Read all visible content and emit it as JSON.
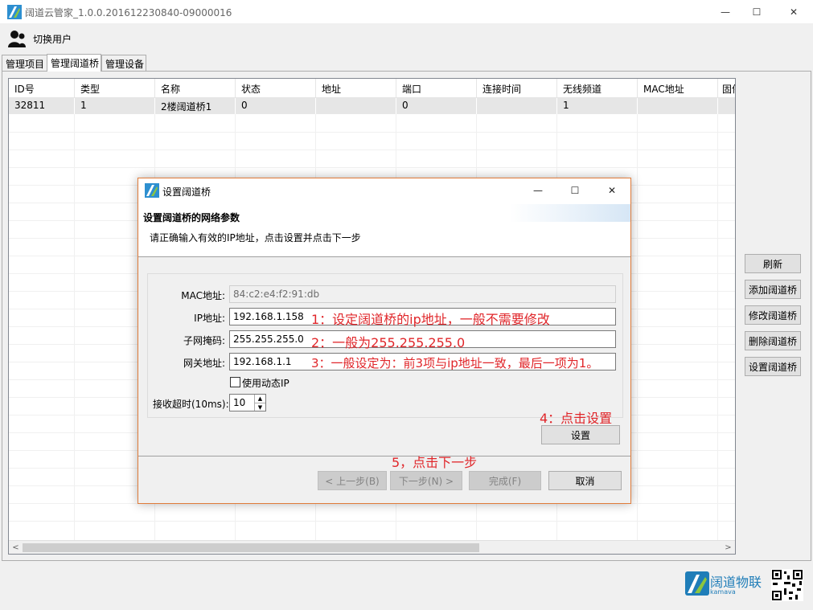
{
  "window": {
    "title": "阔道云管家_1.0.0.201612230840-09000016",
    "minimize": "—",
    "maximize": "☐",
    "close": "✕"
  },
  "toolbar": {
    "switch_user": "切换用户"
  },
  "tabs": [
    "管理项目",
    "管理阔道桥",
    "管理设备"
  ],
  "table": {
    "columns": [
      "ID号",
      "类型",
      "名称",
      "状态",
      "地址",
      "端口",
      "连接时间",
      "无线频道",
      "MAC地址",
      "固件"
    ],
    "rows": [
      [
        "32811",
        "1",
        "2楼阔道桥1",
        "0",
        "",
        "0",
        "",
        "1",
        "",
        ""
      ]
    ]
  },
  "side_buttons": [
    "刷新",
    "添加阔道桥",
    "修改阔道桥",
    "删除阔道桥",
    "设置阔道桥"
  ],
  "brand": {
    "name": "阔道物联",
    "sub": "kamava"
  },
  "dialog": {
    "title": "设置阔道桥",
    "heading": "设置阔道桥的网络参数",
    "subtitle": "请正确输入有效的IP地址，点击设置并点击下一步",
    "fields": {
      "mac_label": "MAC地址:",
      "mac_value": "84:c2:e4:f2:91:db",
      "ip_label": "IP地址:",
      "ip_value": "192.168.1.158",
      "mask_label": "子网掩码:",
      "mask_value": "255.255.255.0",
      "gateway_label": "网关地址:",
      "gateway_value": "192.168.1.1",
      "dhcp_label": "使用动态IP",
      "timeout_label": "接收超时(10ms):",
      "timeout_value": "10"
    },
    "buttons": {
      "set": "设置",
      "prev": "< 上一步(B)",
      "next": "下一步(N) >",
      "finish": "完成(F)",
      "cancel": "取消"
    }
  },
  "annotations": {
    "a1": "1：设定阔道桥的ip地址，一般不需要修改",
    "a2": "2：一般为255.255.255.0",
    "a3": "3：一般设定为：前3项与ip地址一致，最后一项为1。",
    "a4": "4：点击设置",
    "a5": "5，点击下一步"
  },
  "colors": {
    "annotation": "#e0262a",
    "brand": "#1f7db8",
    "dialog_border": "#e07b39"
  }
}
